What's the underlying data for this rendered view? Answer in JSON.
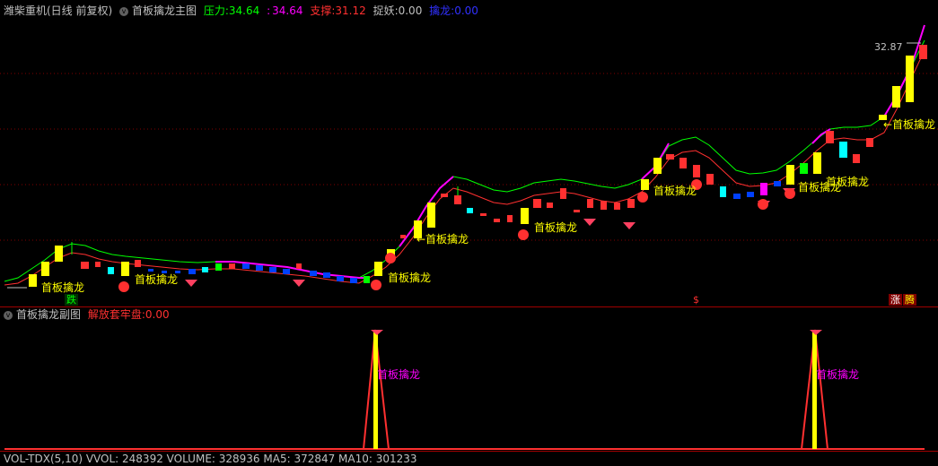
{
  "header_main": {
    "symbol_title": "潍柴重机(日线 前复权)",
    "indicator_name": "首板擒龙主图",
    "pressure_label": "压力:",
    "pressure_value": "34.64",
    "second_value_sep": ":",
    "second_value": "34.64",
    "support_label": "支撑:",
    "support_value": "31.12",
    "catch_label": "捉妖:",
    "catch_value": "0.00",
    "dragon_label": "擒龙:",
    "dragon_value": "0.00"
  },
  "header_sub": {
    "indicator_name": "首板擒龙副图",
    "release_label": "解放套牢盘:",
    "release_value": "0.00"
  },
  "header_vol": {
    "text": "VOL-TDX(5,10) VVOL: 248392 VOLUME: 328936 MA5: 372847 MA10: 301233"
  },
  "colors": {
    "pressure": "#00ff00",
    "magenta": "#ff00ff",
    "support": "#ff3030",
    "catch": "#c0c0c0",
    "dragon": "#3030ff",
    "up_candle": "#ff3030",
    "yellow": "#ffff00",
    "blue": "#0040ff"
  },
  "main_annotations": {
    "price_peak": "32.87",
    "signal_label": "首板擒龙",
    "arrow_label": "←首板擒龙",
    "die_badge": "跌",
    "zhang_badge": "涨",
    "teng_badge": "腾",
    "dollar_badge": "$"
  },
  "sub_annotations": {
    "signal_label_1": "首板擒龙",
    "signal_label_2": "首板擒龙"
  }
}
